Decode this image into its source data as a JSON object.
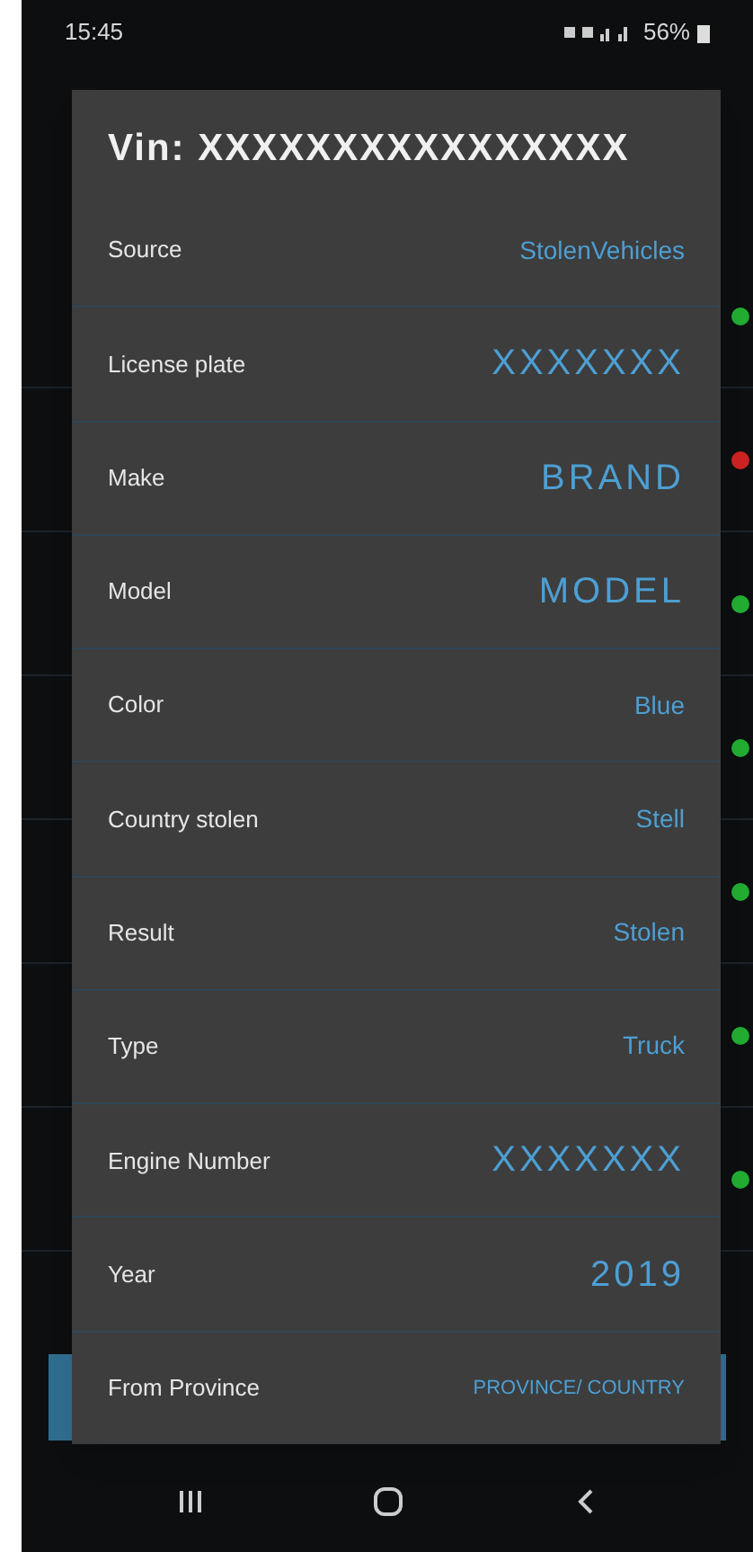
{
  "status_bar": {
    "time": "15:45",
    "battery": "56%"
  },
  "background_list": {
    "rows": [
      {
        "color": "#22aa33"
      },
      {
        "color": "#cc2222"
      },
      {
        "color": "#22aa33"
      },
      {
        "color": "#22aa33"
      },
      {
        "color": "#22aa33"
      },
      {
        "color": "#22aa33"
      },
      {
        "color": "#22aa33"
      }
    ]
  },
  "dialog": {
    "title": "Vin: XXXXXXXXXXXXXXXX",
    "fields": [
      {
        "label": "Source",
        "value": "StolenVehicles",
        "kind": "normal"
      },
      {
        "label": "License plate",
        "value": "XXXXXXX",
        "kind": "large"
      },
      {
        "label": "Make",
        "value": "BRAND",
        "kind": "large"
      },
      {
        "label": "Model",
        "value": "MODEL",
        "kind": "large"
      },
      {
        "label": "Color",
        "value": "Blue",
        "kind": "normal"
      },
      {
        "label": "Country stolen",
        "value": "Stell",
        "kind": "normal"
      },
      {
        "label": "Result",
        "value": "Stolen",
        "kind": "normal"
      },
      {
        "label": "Type",
        "value": "Truck",
        "kind": "normal"
      },
      {
        "label": "Engine Number",
        "value": "XXXXXXX",
        "kind": "large"
      },
      {
        "label": "Year",
        "value": "2019",
        "kind": "large"
      },
      {
        "label": "From Province",
        "value": "PROVINCE/ COUNTRY",
        "kind": "small"
      }
    ]
  }
}
